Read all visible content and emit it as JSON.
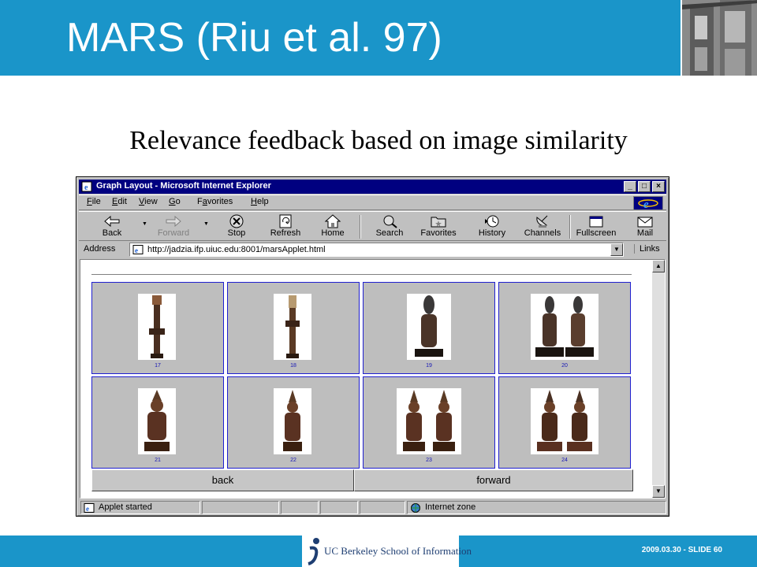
{
  "slide": {
    "title": "MARS (Riu et al. 97)",
    "subtitle": "Relevance feedback based on image similarity",
    "footer_logo_text": "UC Berkeley School of Information",
    "slide_number": "2009.03.30 - SLIDE 60"
  },
  "window": {
    "title": "Graph Layout - Microsoft Internet Explorer",
    "controls": [
      "_",
      "□",
      "×"
    ]
  },
  "menu": [
    {
      "key": "F",
      "rest": "ile"
    },
    {
      "key": "E",
      "rest": "dit"
    },
    {
      "key": "V",
      "rest": "iew"
    },
    {
      "key": "G",
      "rest": "o"
    },
    {
      "pre": "F",
      "key": "a",
      "rest": "vorites"
    },
    {
      "key": "H",
      "rest": "elp"
    }
  ],
  "toolbar": {
    "back": "Back",
    "forward": "Forward",
    "stop": "Stop",
    "refresh": "Refresh",
    "home": "Home",
    "search": "Search",
    "favorites": "Favorites",
    "history": "History",
    "channels": "Channels",
    "fullscreen": "Fullscreen",
    "mail": "Mail"
  },
  "address": {
    "label": "Address",
    "url": "http://jadzia.ifp.uiuc.edu:8001/marsApplet.html",
    "links": "Links"
  },
  "applet": {
    "results": [
      {
        "number": "17",
        "icon": "single-tall-statue-image"
      },
      {
        "number": "18",
        "icon": "single-tall-statue-image"
      },
      {
        "number": "19",
        "icon": "single-statue-image"
      },
      {
        "number": "20",
        "icon": "statue-pair-image"
      },
      {
        "number": "21",
        "icon": "single-statue-image"
      },
      {
        "number": "22",
        "icon": "single-statue-image"
      },
      {
        "number": "23",
        "icon": "statue-pair-image"
      },
      {
        "number": "24",
        "icon": "statue-pair-image"
      }
    ],
    "back_label": "back",
    "forward_label": "forward"
  },
  "status": {
    "message": "Applet started",
    "zone": "Internet zone"
  },
  "colors": {
    "slide_blue": "#1a95c9",
    "ie_titlebar": "#000080",
    "tile_border": "#1f1fd0"
  }
}
